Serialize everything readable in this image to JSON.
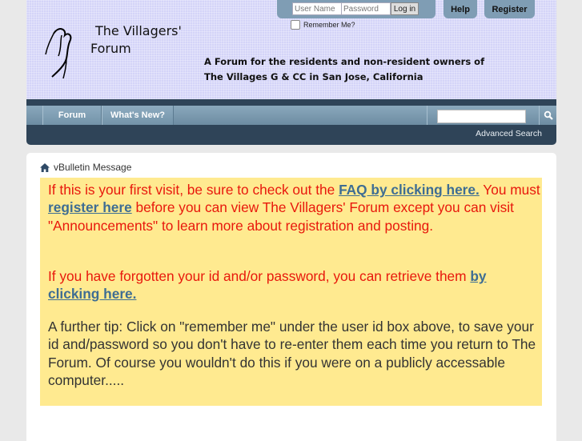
{
  "header": {
    "site_title_line1": "The Villagers'",
    "site_title_line2": "Forum",
    "tagline_line1": "A Forum for the residents and non-resident owners of",
    "tagline_line2": "The Villages G & CC in San Jose, California",
    "login": {
      "username_placeholder": "User Name",
      "password_placeholder": "Password",
      "login_label": "Log in",
      "remember_label": "Remember Me?"
    },
    "help_label": "Help",
    "register_label": "Register"
  },
  "navbar": {
    "tabs": [
      {
        "label": "Forum"
      },
      {
        "label": "What's New?"
      }
    ],
    "search_value": "",
    "advanced_search_label": "Advanced Search"
  },
  "breadcrumb": {
    "icon": "home-icon",
    "label": "vBulletin Message"
  },
  "message": {
    "p1_text1": "If this is your first visit, be sure to check out the ",
    "p1_link1": "FAQ by clicking here.",
    "p1_text2": " You must ",
    "p1_link2": "register here",
    "p1_text3": " before you can view The Villagers' Forum except you can visit \"Announcements\" to learn more about registration and posting.",
    "p2_text1": "If you have forgotten your id and/or password, you can retrieve them ",
    "p2_link1": "by clicking here.",
    "p3_text": "A further tip: Click on \"remember me\" under the user id box above, to save your id and/password so you don't have to re-enter them each time you return to The Forum. Of course you wouldn't do this if you were on a publicly accessable computer....."
  },
  "colors": {
    "header_bg": "#d4d4f8",
    "navbar_bg": "#2f4458",
    "notice_bg": "#ffea90",
    "notice_text": "#e8180c",
    "link": "#3e6d93"
  }
}
